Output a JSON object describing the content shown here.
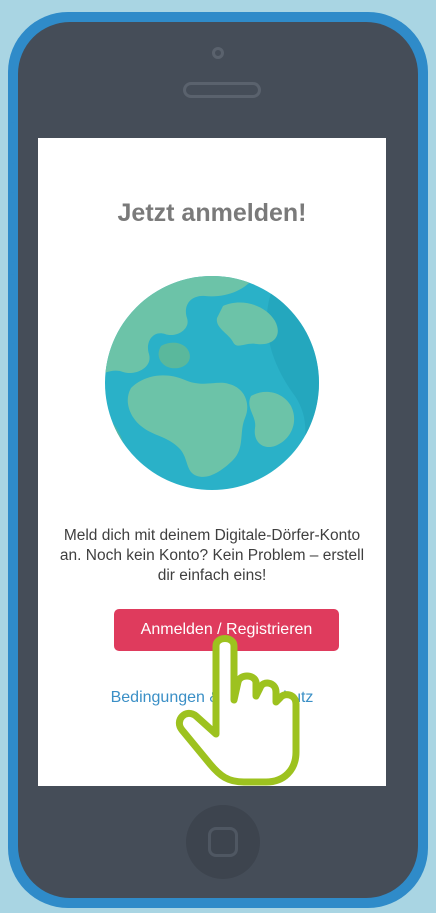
{
  "screen": {
    "title": "Jetzt anmelden!",
    "intro_text": "Meld dich mit deinem Digitale-Dörfer-Konto an. Noch kein Konto? Kein Problem – erstell dir einfach eins!",
    "login_button_label": "Anmelden / Registrieren",
    "footer_link_text": "Bedingungen & Datenschutz"
  },
  "illustration": {
    "icon": "globe-icon"
  },
  "overlay": {
    "icon": "hand-pointer-icon"
  },
  "colors": {
    "background": "#a9d5e3",
    "phone_frame": "#2f8bc9",
    "phone_body": "#454d58",
    "title_text": "#7a7a7a",
    "accent_button": "#df3b5d",
    "link": "#3a8fc6",
    "globe_ocean": "#2ab1c8",
    "globe_land": "#6cc3a8",
    "cursor_outline": "#9dc21f"
  }
}
